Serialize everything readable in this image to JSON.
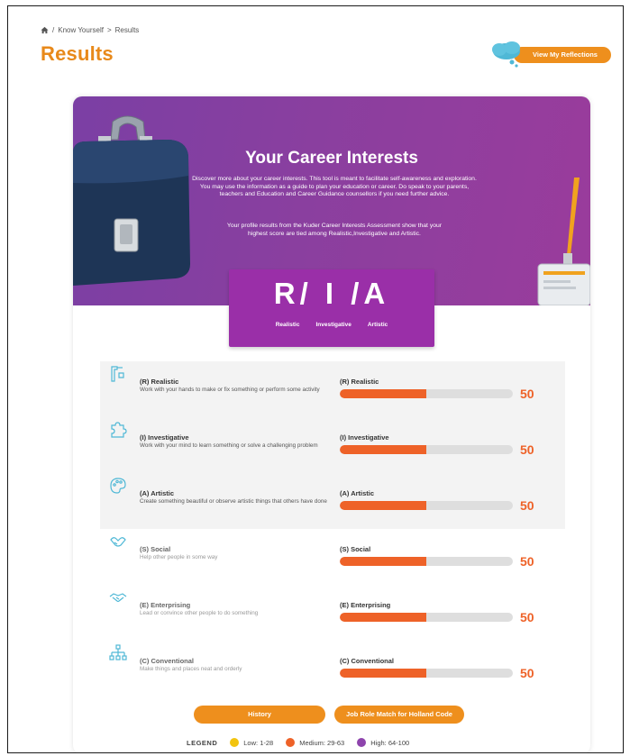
{
  "breadcrumb": {
    "separator": "/",
    "parent": "Know Yourself",
    "arrow": ">",
    "current": "Results"
  },
  "page_title": "Results",
  "reflections_button": "View My Reflections",
  "banner": {
    "title": "Your Career Interests",
    "description": "Discover more about your career interests. This tool is meant to facilitate self-awareness and exploration. You may use the information as a guide to plan your education or career. Do speak to your parents, teachers and Education and Career Guidance counsellors if you need further advice.",
    "profile_text": "Your profile results from the Kuder Career Interests Assessment show that your highest score are tied among Realistic,Investigative and Artistic."
  },
  "riasec": {
    "code": "R/ I /A",
    "labels": [
      "Realistic",
      "Investigative",
      "Artistic"
    ]
  },
  "interests": [
    {
      "title": "(R) Realistic",
      "description": "Work with your hands to make or fix something or perform some activity",
      "bar_label": "(R) Realistic",
      "score": "50",
      "fill_fraction": 0.5,
      "icon": "tools-icon"
    },
    {
      "title": "(I) Investigative",
      "description": "Work with your mind to learn something or solve a challenging problem",
      "bar_label": "(I) Investigative",
      "score": "50",
      "fill_fraction": 0.5,
      "icon": "puzzle-icon"
    },
    {
      "title": "(A) Artistic",
      "description": "Create something beautiful or observe artistic things that others have done",
      "bar_label": "(A) Artistic",
      "score": "50",
      "fill_fraction": 0.5,
      "icon": "palette-icon"
    },
    {
      "title": "(S) Social",
      "description": "Help other people in some way",
      "bar_label": "(S) Social",
      "score": "50",
      "fill_fraction": 0.5,
      "icon": "helping-hands-icon"
    },
    {
      "title": "(E) Enterprising",
      "description": "Lead or convince other people to do something",
      "bar_label": "(E) Enterprising",
      "score": "50",
      "fill_fraction": 0.5,
      "icon": "handshake-icon"
    },
    {
      "title": "(C) Conventional",
      "description": "Make things and places neat and orderly",
      "bar_label": "(C) Conventional",
      "score": "50",
      "fill_fraction": 0.5,
      "icon": "org-chart-icon"
    }
  ],
  "buttons": {
    "history": "History",
    "job_match": "Job Role Match for Holland Code"
  },
  "legend": {
    "title": "LEGEND",
    "items": [
      {
        "label": "Low: 1-28",
        "color": "#f2c40f"
      },
      {
        "label": "Medium: 29-63",
        "color": "#ee6228"
      },
      {
        "label": "High: 64-100",
        "color": "#8e44ad"
      }
    ]
  },
  "colors": {
    "accent": "#ee8f1d",
    "title": "#e8891a",
    "bar": "#ee6228",
    "banner": "#8a3f9f",
    "code_box": "#9a2fa8",
    "icon": "#4fb8d6"
  }
}
